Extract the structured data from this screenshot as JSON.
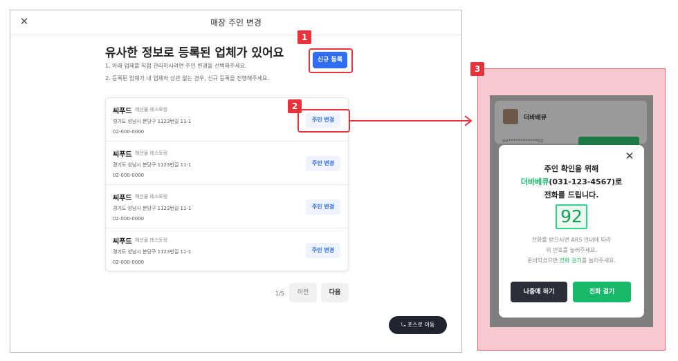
{
  "modal": {
    "title": "매장 주인 변경",
    "close_icon": "close-icon",
    "heading": "유사한 정보로 등록된 업체가 있어요",
    "note1": "1. 아래 업체를 직접 관리하시려면 주인 변경을 선택해주세요.",
    "note2": "2. 등록된 업체가 내 업체와 상관 없는 경우, 신규 등록을 진행해주세요.",
    "new_register_label": "신규 등록",
    "stores": [
      {
        "name": "씨푸드",
        "category": "해산물 레스토랑",
        "address": "경기도 성남시 분당구 1123번길 11-1",
        "phone": "02-000-0000",
        "button": "주인 변경"
      },
      {
        "name": "씨푸드",
        "category": "해산물 레스토랑",
        "address": "경기도 성남시 분당구 1123번길 11-1",
        "phone": "02-000-0000",
        "button": "주인 변경"
      },
      {
        "name": "씨푸드",
        "category": "해산물 레스토랑",
        "address": "경기도 성남시 분당구 1123번길 11-1",
        "phone": "02-000-0000",
        "button": "주인 변경"
      },
      {
        "name": "씨푸드",
        "category": "해산물 레스토랑",
        "address": "경기도 성남시 분당구 1123번길 11-1",
        "phone": "02-000-0000",
        "button": "주인 변경"
      }
    ],
    "pager": {
      "count": "1/5",
      "prev": "이전",
      "next": "다음"
    },
    "pos_button": "⤿ 포스로 이동"
  },
  "annotations": {
    "badge1": "1",
    "badge2": "2",
    "badge3": "3",
    "accent": "#e8333c"
  },
  "panel": {
    "store_title": "더바베큐",
    "masked_id": "nv************02",
    "dialog": {
      "line1": "주인 확인을 위해",
      "line2_green": "더바베큐",
      "line2_rest": "(031-123-4567)로",
      "line3": "전화를 드립니다.",
      "code": "92",
      "sub1": "전화를 받으시면 ARS 안내에 따라",
      "sub2": "위 번호를 눌러주세요.",
      "sub3_a": "준비되셨으면 ",
      "sub3_green": "전화 걸기",
      "sub3_b": "를 눌러주세요.",
      "later_label": "나중에 하기",
      "call_label": "전화 걸기"
    }
  }
}
